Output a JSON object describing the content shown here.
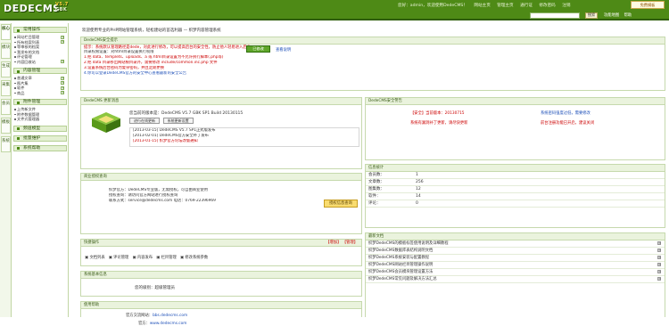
{
  "header": {
    "logo": "DEDECMS",
    "logo_version": "V5.7",
    "logo_edition": "GBK",
    "nav": [
      "您好：admin，欢迎使用DedeCMS！",
      "网站主页",
      "管理主页",
      "通行证",
      "修改密码",
      "注销"
    ],
    "search_placeholder": "",
    "search_button": "搜索",
    "right_links": [
      "功能地图",
      "帮助"
    ],
    "hot_button": "免费模板"
  },
  "tabs": [
    "核心",
    "模块",
    "生成",
    "采集",
    "会员",
    "模板",
    "系统"
  ],
  "sidebar": {
    "sections": [
      {
        "title": "常用操作",
        "items": [
          {
            "label": "网站栏目管理",
            "plus": true
          },
          {
            "label": "所有档案列表",
            "plus": true
          },
          {
            "label": "等审核的档案",
            "plus": false
          },
          {
            "label": "我发布的文档",
            "plus": false
          },
          {
            "label": "评论管理",
            "plus": false
          },
          {
            "label": "内容回收站",
            "plus": true
          }
        ]
      },
      {
        "title": "内容管理",
        "items": [
          {
            "label": "普通文章",
            "plus": true
          },
          {
            "label": "图片集",
            "plus": true
          },
          {
            "label": "软件",
            "plus": true
          },
          {
            "label": "商品",
            "plus": true
          }
        ]
      },
      {
        "title": "附件管理",
        "items": [
          {
            "label": "上传新文件",
            "plus": false
          },
          {
            "label": "附件数据管理",
            "plus": false
          },
          {
            "label": "文件式管理器",
            "plus": false
          }
        ]
      },
      {
        "title": "频道模型",
        "items": []
      },
      {
        "title": "批量维护",
        "items": []
      },
      {
        "title": "系统帮助",
        "items": []
      }
    ]
  },
  "welcome": "欢迎使用专业的PHP网站管理系统，轻松建站的首选利器 — 织梦内容管理系统",
  "notice": {
    "title": "DedeCMS安全提示",
    "lines": [
      "提示：系统默认管理路径是dede，对此进行修改，可以提高后台的安全性，防止他人轻易进入后台",
      "目录权限设置：对html目录设置执行权限",
      "1.把 data、templets、uploads、a 或 html目录设置为不允许执行脚本(.php等)",
      "2.把 data 目录移出网站根目录外，需要修改 include/common.inc.php 文件",
      "3.设置系统后台密码为复杂密码，并且定期更换",
      "4.你可以登录DedeCMS官方的安全中心查看最新的安全公告"
    ],
    "button": "已修改",
    "link": "查看说明"
  },
  "info": {
    "title": "DedeCMS 更新消息",
    "version_line": "您当前的版本是：DedeCMS V5.7 GBK SP1 Build 20130115",
    "buttons": [
      "进行在线更新",
      "系统更新设置"
    ],
    "news": [
      "[2013-03-15] DedeCMS V5.7 SP1正式版发布",
      "[2013-02-01] DedeCMS官方安全补丁发布",
      "[2013-01-15] 织梦官方论坛改版通知"
    ]
  },
  "business": {
    "title": "商业授权查询",
    "lines": [
      "织梦官方：DedeCMS专业版，无需授权，可自由商业使用",
      "授权查询：请访问官方网站进行授权查询",
      "联系方式：service@dedecms.com 电话：0769-22396969"
    ],
    "button": "授权信息查询"
  },
  "quick": {
    "title": "快捷操作",
    "actions": [
      "【增加】",
      "【管理】"
    ],
    "items": [
      "文档列表",
      "评论管理",
      "内容发布",
      "栏目管理",
      "修改系统参数"
    ]
  },
  "system": {
    "title": "系统基本信息",
    "label": "您的级别：",
    "value": "超级管理员"
  },
  "usage": {
    "title": "使用帮助",
    "rows": [
      {
        "label": "官方交流网站：",
        "value": "bbs.dedecms.com"
      },
      {
        "label": "官方：",
        "value": "www.dedecms.com"
      }
    ]
  },
  "security": {
    "title": "DedeCMS安全警告",
    "left_top": "【安全】当前版本：20130715",
    "left_bottom": "系统有漏洞补丁更新，请尽快更新",
    "right_top": "系统密码强度过低，需要修改",
    "right_bottom": "前台注册功能已开启，建议关闭"
  },
  "stats": {
    "title": "信息统计",
    "rows": [
      {
        "label": "会员数：",
        "value": "1"
      },
      {
        "label": "文章数：",
        "value": "256"
      },
      {
        "label": "图集数：",
        "value": "12"
      },
      {
        "label": "软件：",
        "value": "14"
      },
      {
        "label": "评论：",
        "value": "0"
      }
    ]
  },
  "docs": {
    "title": "最新文档",
    "rows": [
      "织梦DedeCMS的模板标签使用说明及详细教程",
      "织梦DedeCMS数据库表结构说明文档",
      "织梦DedeCMS系统安装与配置教程",
      "织梦DedeCMS网站栏目管理操作说明",
      "织梦DedeCMS会员模块管理设置方法",
      "织梦DedeCMS常见问题及解决方法汇总"
    ]
  },
  "colors": {
    "brand": "#4e8a16",
    "accent": "#cc0000",
    "link": "#1d4fb8"
  }
}
